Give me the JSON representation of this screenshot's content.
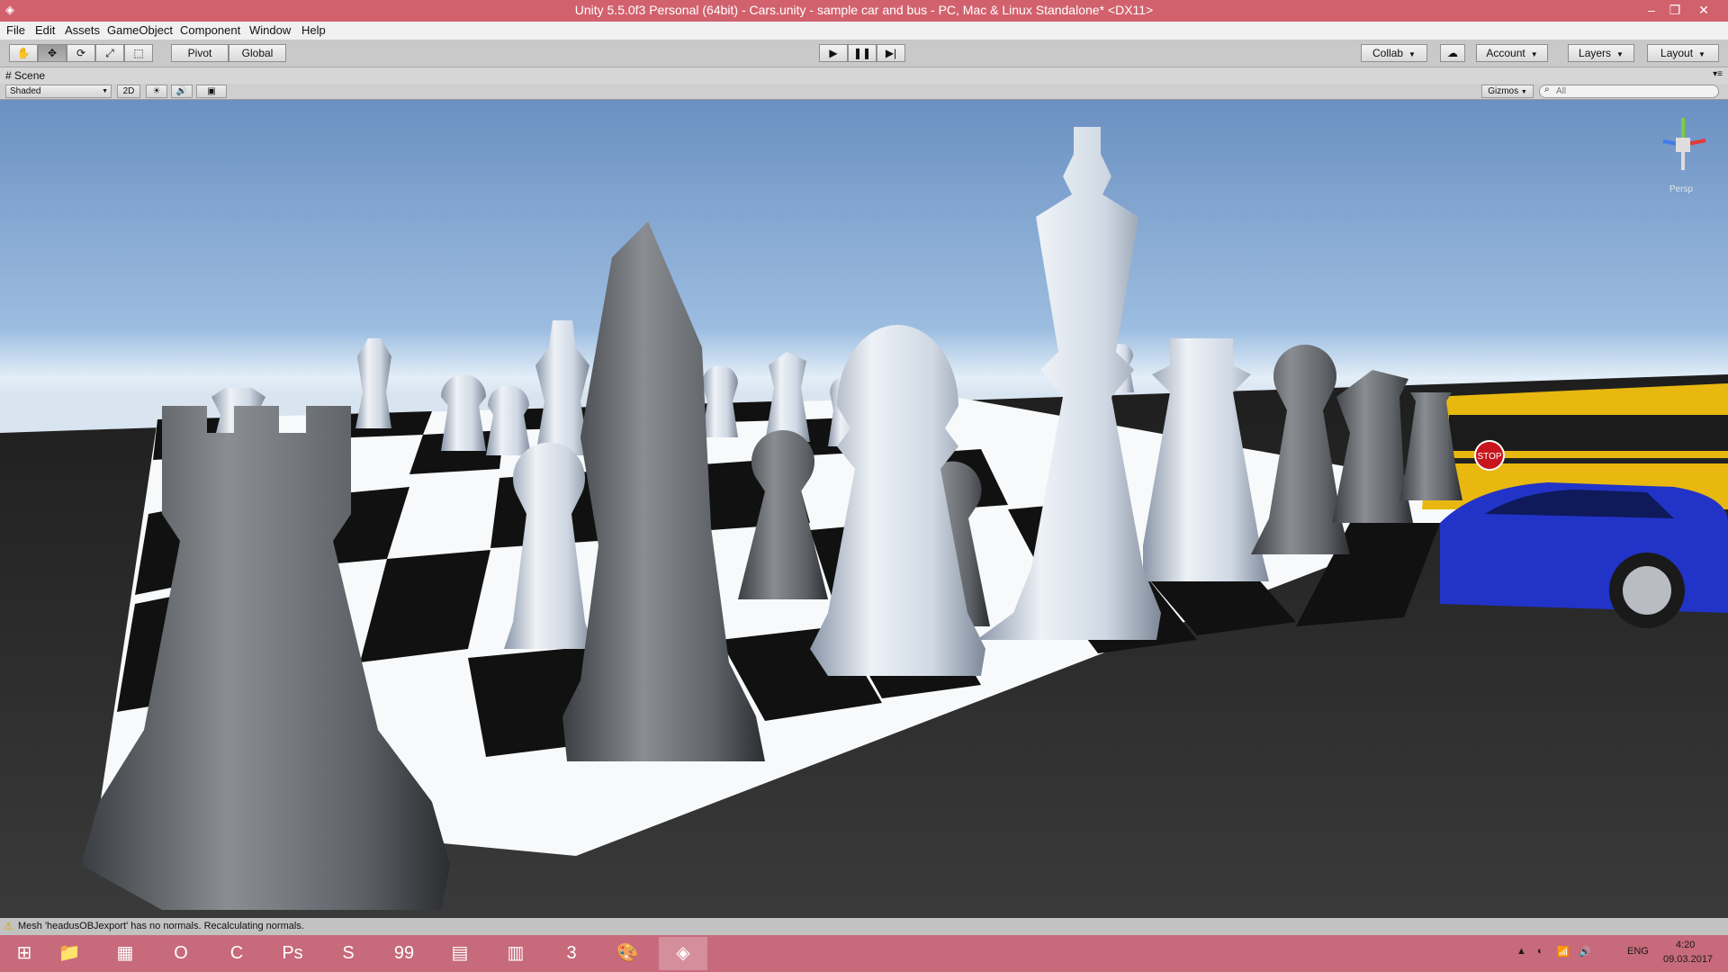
{
  "window": {
    "title": "Unity 5.5.0f3 Personal (64bit) - Cars.unity - sample car and bus - PC, Mac & Linux Standalone* <DX11>",
    "app_icon": "unity-icon",
    "min_glyph": "–",
    "max_glyph": "❐",
    "close_glyph": "✕"
  },
  "menu": [
    "File",
    "Edit",
    "Assets",
    "GameObject",
    "Component",
    "Window",
    "Help"
  ],
  "toolbar": {
    "transform_tools": [
      {
        "name": "hand-tool-icon",
        "glyph": "✋"
      },
      {
        "name": "move-tool-icon",
        "glyph": "✥"
      },
      {
        "name": "rotate-tool-icon",
        "glyph": "⟳"
      },
      {
        "name": "scale-tool-icon",
        "glyph": "⤢"
      },
      {
        "name": "rect-tool-icon",
        "glyph": "⬚"
      }
    ],
    "pivot_label": "Pivot",
    "global_label": "Global",
    "play_glyph": "▶",
    "pause_glyph": "❚❚",
    "step_glyph": "▶|",
    "collab_label": "Collab",
    "cloud_glyph": "☁",
    "account_label": "Account",
    "layers_label": "Layers",
    "layout_label": "Layout"
  },
  "scene": {
    "tab_label": "Scene",
    "shading_mode": "Shaded",
    "mode_2d_label": "2D",
    "lighting_glyph": "☀",
    "audio_glyph": "🔊",
    "effects_glyph": "▣",
    "gizmos_label": "Gizmos",
    "search_placeholder": "All",
    "gizmo_persp_label": "Persp",
    "stop_sign_text": "STOP"
  },
  "status": {
    "warning_glyph": "⚠",
    "message": "Mesh 'headusOBJexport' has no normals. Recalculating normals."
  },
  "taskbar": {
    "apps": [
      {
        "name": "file-explorer-icon",
        "glyph": "📁"
      },
      {
        "name": "store-icon",
        "glyph": "▦"
      },
      {
        "name": "opera-icon",
        "glyph": "O"
      },
      {
        "name": "ccleaner-icon",
        "glyph": "C"
      },
      {
        "name": "photoshop-icon",
        "glyph": "Ps"
      },
      {
        "name": "skype-icon",
        "glyph": "S"
      },
      {
        "name": "total-commander-icon",
        "glyph": "99"
      },
      {
        "name": "image-viewer-icon",
        "glyph": "▤"
      },
      {
        "name": "winrar-icon",
        "glyph": "▥"
      },
      {
        "name": "3dsmax-icon",
        "glyph": "3"
      },
      {
        "name": "paint-icon",
        "glyph": "🎨"
      },
      {
        "name": "unity-taskbar-icon",
        "glyph": "◈"
      }
    ],
    "language": "ENG",
    "time": "4:20",
    "date": "09.03.2017"
  },
  "colors": {
    "titlebar": "#d2616e",
    "taskbar": "#c76a7b",
    "sky_top": "#6e93c6",
    "sky_horizon": "#e6f0f8",
    "ground": "#2a2a2a",
    "board_light": "#ffffff",
    "board_dark": "#151515",
    "bus_yellow": "#e9b911",
    "car_blue": "#2030c8"
  }
}
